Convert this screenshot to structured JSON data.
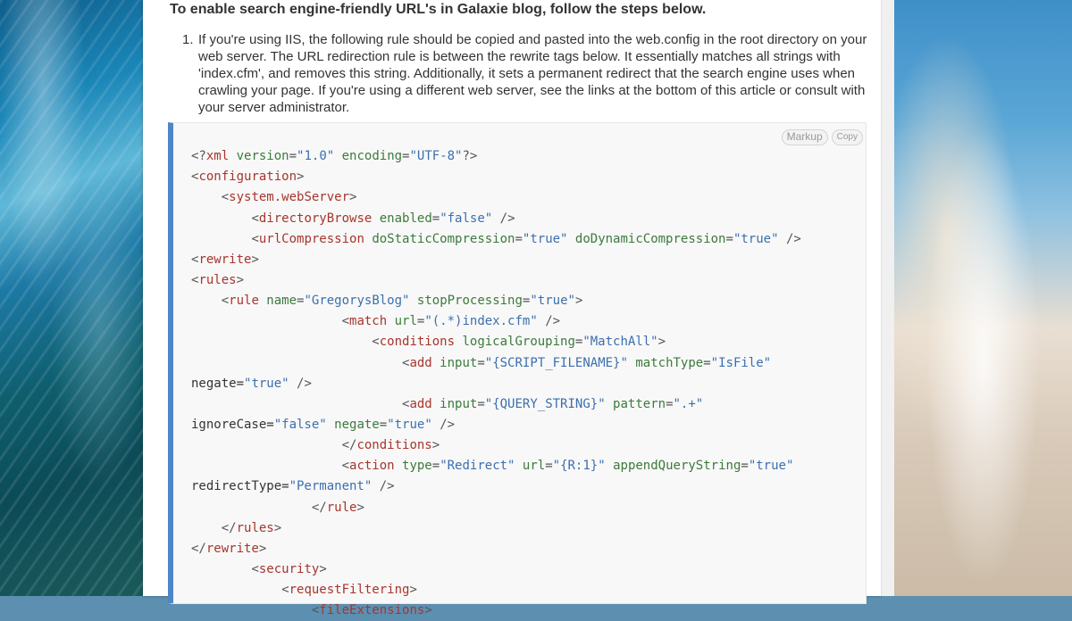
{
  "article": {
    "heading": "To enable search engine-friendly URL's in Galaxie blog, follow the steps below.",
    "steps": [
      {
        "number": "1.",
        "text": "If you're using IIS, the following rule should be copied and pasted into the web.config in the root directory on your web server. The URL redirection rule is between the rewrite tags below. It essentially matches all strings with 'index.cfm', and removes this string. Additionally, it sets a permanent redirect that the search engine uses when crawling your page.  If you're using a different web server, see the links at the bottom of this article or consult with your server administrator."
      }
    ]
  },
  "code_toolbar": {
    "markup_label": "Markup",
    "copy_label": "Copy"
  },
  "code_lines": [
    "",
    "<?xml version=\"1.0\" encoding=\"UTF-8\"?>",
    "<configuration>",
    "    <system.webServer>",
    "        <directoryBrowse enabled=\"false\" />",
    "        <urlCompression doStaticCompression=\"true\" doDynamicCompression=\"true\" />",
    "<rewrite>",
    "<rules>",
    "    <rule name=\"GregorysBlog\" stopProcessing=\"true\">",
    "                    <match url=\"(.*)index.cfm\" />",
    "                        <conditions logicalGrouping=\"MatchAll\">",
    "                            <add input=\"{SCRIPT_FILENAME}\" matchType=\"IsFile\"",
    "negate=\"true\" />",
    "                            <add input=\"{QUERY_STRING}\" pattern=\".+\"",
    "ignoreCase=\"false\" negate=\"true\" />",
    "                    </conditions>",
    "                    <action type=\"Redirect\" url=\"{R:1}\" appendQueryString=\"true\"",
    "redirectType=\"Permanent\" />",
    "                </rule>",
    "    </rules>",
    "</rewrite>",
    "        <security>",
    "            <requestFiltering>",
    "                <fileExtensions>"
  ],
  "colors": {
    "code_border_accent": "#4e86c8",
    "tag": "#a7352c",
    "attribute": "#3c7a3c",
    "value": "#3b6fae"
  }
}
